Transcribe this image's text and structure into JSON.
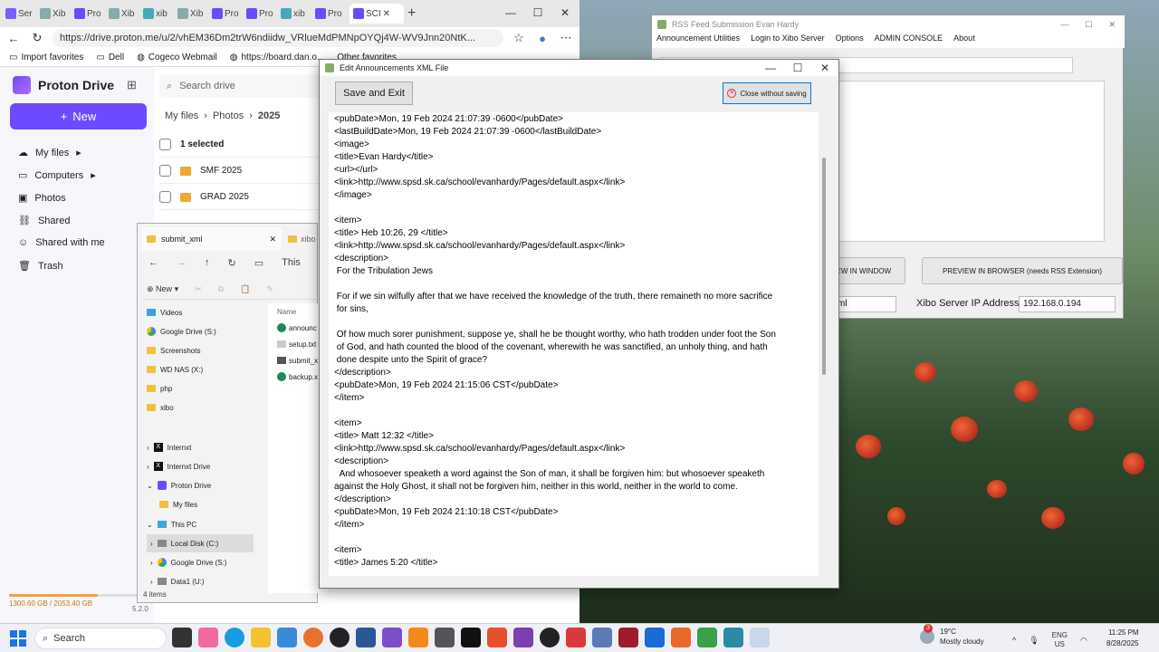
{
  "browser": {
    "tabs": [
      "Ser",
      "Xib",
      "Pro",
      "Xib",
      "xib",
      "Xib",
      "Pro",
      "Pro",
      "xib",
      "Pro",
      "SCI"
    ],
    "url": "https://drive.proton.me/u/2/vhEM36Dm2trW6ndiidw_VRlueMdPMNpOYQj4W-WV9Jnn20NtK...",
    "favorites": [
      "Import favorites",
      "Dell",
      "Cogeco Webmail",
      "https://board.dan.o...",
      "Other favorites"
    ]
  },
  "proton": {
    "brand": "Proton Drive",
    "new_label": "New",
    "nav": [
      "My files",
      "Computers",
      "Photos",
      "Shared",
      "Shared with me",
      "Trash"
    ],
    "search_placeholder": "Search drive",
    "breadcrumb": [
      "My files",
      "Photos",
      "2025"
    ],
    "selected": "1 selected",
    "folders": [
      "SMF 2025",
      "GRAD 2025"
    ],
    "storage": "1300.60 GB / 2053.40 GB",
    "version": "5.2.0"
  },
  "explorer": {
    "tab_title": "submit_xml",
    "tab2_title": "xibo",
    "path_label": "This",
    "new_label": "New",
    "column_name": "Name",
    "tree": [
      "Videos",
      "Google Drive (S:)",
      "Screenshots",
      "WD NAS (X:)",
      "php",
      "xibo",
      "Internxt",
      "Internxt Drive",
      "Proton Drive",
      "My files",
      "This PC",
      "Local Disk (C:)",
      "Google Drive (S:)",
      "Data1 (U:)"
    ],
    "files": [
      "announc",
      "setup.txt",
      "submit_x",
      "backup.x"
    ],
    "status": "4 items"
  },
  "rss": {
    "title": "RSS Feed Submission Evan Hardy",
    "menu": [
      "Announcement Utilities",
      "Login to Xibo Server",
      "Options",
      "ADMIN CONSOLE",
      "About"
    ],
    "btn_window": "VIEW IN WINDOW",
    "btn_browser": "PREVIEW IN BROWSER (needs RSS Extension)",
    "file_value": "ml",
    "ip_label": "Xibo Server IP Address:",
    "ip_value": "192.168.0.194"
  },
  "editor": {
    "title": "Edit Announcements XML File",
    "save_label": "Save and Exit",
    "close_label": "Close without saving",
    "text": "<pubDate>Mon, 19 Feb 2024 21:07:39 -0600</pubDate>\n<lastBuildDate>Mon, 19 Feb 2024 21:07:39 -0600</lastBuildDate>\n<image>\n<title>Evan Hardy</title>\n<url></url>\n<link>http://www.spsd.sk.ca/school/evanhardy/Pages/default.aspx</link>\n</image>\n\n<item>\n<title> Heb 10:26, 29 </title>\n<link>http://www.spsd.sk.ca/school/evanhardy/Pages/default.aspx</link>\n<description>\n For the Tribulation Jews\n\n For if we sin wilfully after that we have received the knowledge of the truth, there remaineth no more sacrifice\n for sins,\n\n Of how much sorer punishment, suppose ye, shall he be thought worthy, who hath trodden under foot the Son\n of God, and hath counted the blood of the covenant, wherewith he was sanctified, an unholy thing, and hath\n done despite unto the Spirit of grace?\n</description>\n<pubDate>Mon, 19 Feb 2024 21:15:06 CST</pubDate>\n</item>\n\n<item>\n<title> Matt 12:32 </title>\n<link>http://www.spsd.sk.ca/school/evanhardy/Pages/default.aspx</link>\n<description>\n  And whosoever speaketh a word against the Son of man, it shall be forgiven him: but whosoever speaketh\nagainst the Holy Ghost, it shall not be forgiven him, neither in this world, neither in the world to come.\n</description>\n<pubDate>Mon, 19 Feb 2024 21:10:18 CST</pubDate>\n</item>\n\n<item>\n<title> James 5:20 </title>"
  },
  "taskbar": {
    "search_label": "Search",
    "weather_temp": "19°C",
    "weather_desc": "Mostly cloudy",
    "weather_badge": "3",
    "lang": "ENG",
    "region": "US",
    "time": "11:25 PM",
    "date": "8/28/2025"
  }
}
